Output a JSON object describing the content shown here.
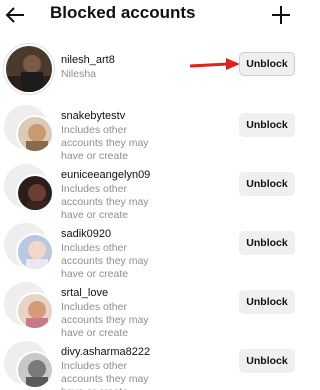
{
  "header": {
    "title": "Blocked accounts",
    "back_icon": "arrow-left-icon",
    "add_icon": "plus-icon"
  },
  "accounts": [
    {
      "username": "nilesh_art8",
      "subtitle": "Nilesha",
      "button": "Unblock"
    },
    {
      "username": "snakebytestv",
      "subtitle": "Includes other accounts they may have or create",
      "button": "Unblock"
    },
    {
      "username": "euniceeangelyn09",
      "subtitle": "Includes other accounts they may have or create",
      "button": "Unblock"
    },
    {
      "username": "sadik0920",
      "subtitle": "Includes other accounts they may have or create",
      "button": "Unblock"
    },
    {
      "username": "srtal_love",
      "subtitle": "Includes other accounts they may have or create",
      "button": "Unblock"
    },
    {
      "username": "divy.asharma8222",
      "subtitle": "Includes other accounts they may have or create",
      "button": "Unblock"
    }
  ],
  "annotation": {
    "arrow_icon": "red-arrow-icon",
    "color": "#e0201b"
  },
  "colors": {
    "button_bg": "#efefef",
    "subtext": "#8e8e8e"
  }
}
